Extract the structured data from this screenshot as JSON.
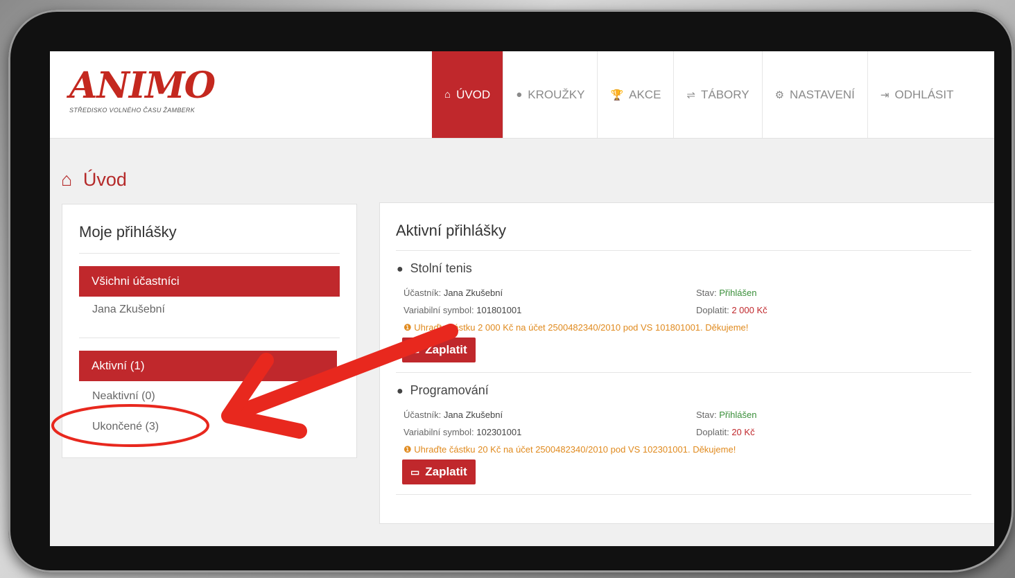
{
  "logo": {
    "word": "ANIMO",
    "sub": "STŘEDISKO VOLNÉHO ČASU ŽAMBERK"
  },
  "nav": [
    {
      "label": "ÚVOD",
      "icon": "⌂"
    },
    {
      "label": "KROUŽKY",
      "icon": "●"
    },
    {
      "label": "AKCE",
      "icon": "🏆"
    },
    {
      "label": "TÁBORY",
      "icon": "⇌"
    },
    {
      "label": "NASTAVENÍ",
      "icon": "⚙"
    },
    {
      "label": "ODHLÁSIT",
      "icon": "⇥"
    }
  ],
  "page": {
    "title": "Úvod",
    "icon": "⌂"
  },
  "left": {
    "heading": "Moje přihlášky",
    "all_participants": "Všichni účastníci",
    "participant": "Jana Zkušební",
    "active": "Aktivní (1)",
    "inactive": "Neaktivní (0)",
    "finished": "Ukončené (3)"
  },
  "right": {
    "heading": "Aktivní přihlášky",
    "entries": [
      {
        "title": "Stolní tenis",
        "participant_label": "Účastník:",
        "participant": "Jana Zkušební",
        "vs_label": "Variabilní symbol:",
        "vs": "101801001",
        "status_label": "Stav:",
        "status": "Přihlášen",
        "due_label": "Doplatit:",
        "due": "2 000 Kč",
        "notice": "Uhraďte částku 2 000 Kč na účet 2500482340/2010 pod VS 101801001. Děkujeme!",
        "pay": "Zaplatit"
      },
      {
        "title": "Programování",
        "participant_label": "Účastník:",
        "participant": "Jana Zkušební",
        "vs_label": "Variabilní symbol:",
        "vs": "102301001",
        "status_label": "Stav:",
        "status": "Přihlášen",
        "due_label": "Doplatit:",
        "due": "20 Kč",
        "notice": "Uhraďte částku 20 Kč na účet 2500482340/2010 pod VS 102301001. Děkujeme!",
        "pay": "Zaplatit"
      }
    ]
  },
  "colors": {
    "brand_red": "#c0282c",
    "annotation_red": "#e8281e",
    "status_green": "#3a8f3a",
    "warning_orange": "#e08a1e"
  }
}
